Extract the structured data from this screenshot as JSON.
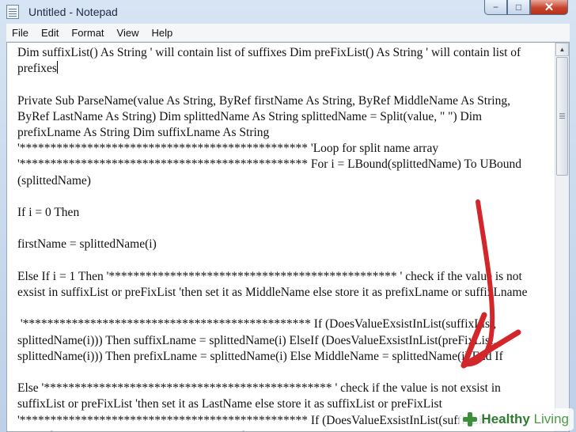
{
  "window": {
    "title": "Untitled - Notepad",
    "minimize_glyph": "−",
    "maximize_glyph": "□",
    "close_glyph": "✕"
  },
  "menu": [
    "File",
    "Edit",
    "Format",
    "View",
    "Help"
  ],
  "editor": {
    "lines": [
      "Dim suffixList() As String ' will contain list of suffixes Dim preFixList() As String ' will contain list of",
      "prefixes",
      "",
      "Private Sub ParseName(value As String, ByRef firstName As String, ByRef MiddleName As String,",
      "ByRef LastName As String) Dim splittedName As String splittedName = Split(value, \" \") Dim",
      "prefixLname As String Dim suffixLname As String",
      "'*********************************************** 'Loop for split name array",
      "'*********************************************** For i = LBound(splittedName) To UBound",
      "(splittedName)",
      "",
      "If i = 0 Then",
      "",
      "firstName = splittedName(i)",
      "",
      "Else If i = 1 Then '*********************************************** ' check if the value is not",
      "exsist in suffixList or preFixList 'then set it as MiddleName else store it as prefixLname or suffixLname",
      "",
      " '*********************************************** If (DoesValueExsistInList(suffixList,",
      "splittedName(i))) Then suffixLname = splittedName(i) ElseIf (DoesValueExsistInList(preFixList,",
      "splittedName(i))) Then prefixLname = splittedName(i) Else MiddleName = splittedName(i) End If",
      "",
      "Else '*********************************************** ' check if the value is not exsist in",
      "suffixList or preFixList 'then set it as LastName else store it as suffixList or preFixList",
      "'*********************************************** If (DoesValueExsistInList(suffixList,",
      "splittedName(i))) Then suffixLname = splittedName(i) ElseIf (DoesValueExsistInList(preFixList,"
    ]
  },
  "watermark": {
    "brand_bold": "Healthy",
    "brand_light": "Living"
  },
  "colors": {
    "annotation_arrow": "#d3262a",
    "close_button": "#c7432c",
    "brand_green": "#3b8f3a"
  }
}
